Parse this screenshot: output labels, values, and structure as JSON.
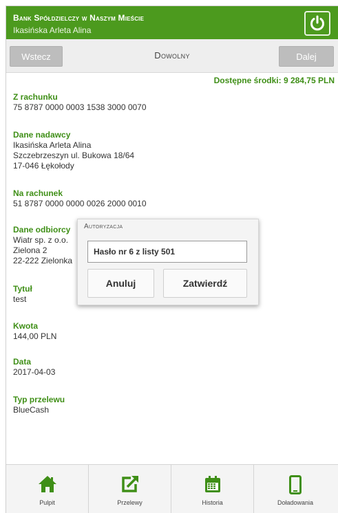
{
  "header": {
    "bank_name": "Bank Spółdzielczy w Naszym Mieście",
    "user_name": "Ikasińska Arleta Alina",
    "logout_icon": "power-icon"
  },
  "toolbar": {
    "back_label": "Wstecz",
    "title": "Dowolny",
    "next_label": "Dalej"
  },
  "available_funds": "Dostępne środki: 9 284,75 PLN",
  "fields": {
    "from_account": {
      "label": "Z rachunku",
      "value": "75 8787 0000 0003 1538 3000 0070"
    },
    "sender": {
      "label": "Dane nadawcy",
      "line1": "Ikasińska Arleta Alina",
      "line2": "Szczebrzeszyn ul. Bukowa 18/64",
      "line3": "17-046 Łękołody"
    },
    "to_account": {
      "label": "Na rachunek",
      "value": "51 8787 0000 0000 0026 2000 0010"
    },
    "recipient": {
      "label": "Dane odbiorcy",
      "line1": "Wiatr sp. z o.o.",
      "line2": "Zielona 2",
      "line3": "22-222 Zielonka"
    },
    "title": {
      "label": "Tytuł",
      "value": "test"
    },
    "amount": {
      "label": "Kwota",
      "value": "144,00 PLN"
    },
    "date": {
      "label": "Data",
      "value": "2017-04-03"
    },
    "transfer_type": {
      "label": "Typ przelewu",
      "value": "BlueCash"
    }
  },
  "auth_dialog": {
    "title": "Autoryzacja",
    "input_value": "Hasło nr 6 z listy 501",
    "cancel_label": "Anuluj",
    "confirm_label": "Zatwierdź"
  },
  "bottom_nav": [
    {
      "label": "Pulpit",
      "icon": "home-icon"
    },
    {
      "label": "Przelewy",
      "icon": "transfer-icon"
    },
    {
      "label": "Historia",
      "icon": "calendar-icon"
    },
    {
      "label": "Doładowania",
      "icon": "phone-icon"
    }
  ],
  "colors": {
    "brand_green": "#4c9a1e",
    "label_green": "#3f8f17"
  }
}
